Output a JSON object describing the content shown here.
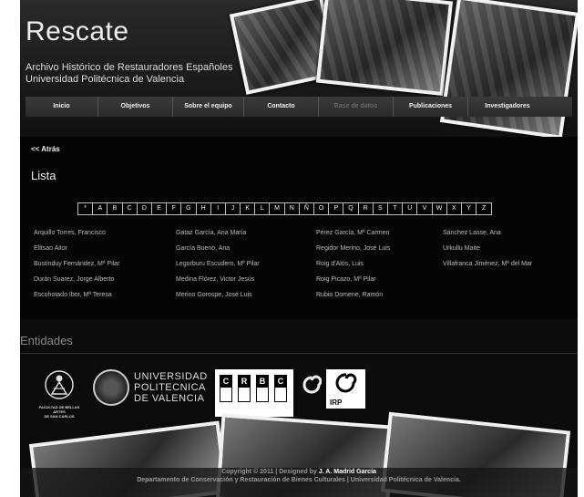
{
  "header": {
    "title": "Rescate",
    "subtitle_line1": "Archivo Histórico de Restauradores Españoles",
    "subtitle_line2": "Universidad Politécnica de Valencia"
  },
  "nav": {
    "items": [
      {
        "label": "Inicio"
      },
      {
        "label": "Objetivos"
      },
      {
        "label": "Sobre el equipo"
      },
      {
        "label": "Contacto"
      },
      {
        "label": "Base de datos"
      },
      {
        "label": "Publicaciones"
      },
      {
        "label": "Investigadores"
      }
    ]
  },
  "content": {
    "back_link": "<< Atrás",
    "list_title": "Lista",
    "alphabet": [
      "*",
      "A",
      "B",
      "C",
      "D",
      "E",
      "F",
      "G",
      "H",
      "I",
      "J",
      "K",
      "L",
      "M",
      "N",
      "Ñ",
      "O",
      "P",
      "Q",
      "R",
      "S",
      "T",
      "U",
      "V",
      "W",
      "X",
      "Y",
      "Z"
    ],
    "names": [
      "Arquillo Torres, Francisco",
      "Gataz García, Ana María",
      "Pérez García, Mª Carmen",
      "Sánchez Lasse, Ana",
      "Elitsao Aitor",
      "García Bueno, Ana",
      "Regidor Merino, José Luis",
      "Urkullu Maite",
      "Bustinduy Fernández, Mª Pilar",
      "Legorburu Escudero, Mª Pilar",
      "Roig d'Alós, Luis",
      "Villafranca Jiménez, Mª del Mar",
      "Durán Suarez, Jorge Alberto",
      "Medina Flórez, Victor Jesús",
      "Roig Picazo, Mª Pilar",
      "",
      "Escohotado Ibor, Mª Teresa",
      "Merino Gorospe, José Luis",
      "Rubio Domene, Ramón",
      ""
    ]
  },
  "entities": {
    "heading": "Entidades",
    "bba_label_1": "FACULTAD DE BELLAS ARTES",
    "bba_label_2": "DE SAN CARLOS",
    "upv_line1": "UNIVERSIDAD",
    "upv_line2": "POLITECNICA",
    "upv_line3": "DE VALENCIA",
    "crbc_letters": [
      "C",
      "R",
      "B",
      "C"
    ],
    "irp_label": "IRP"
  },
  "footer": {
    "line1_prefix": "Copyright © 2011 | Designed by ",
    "line1_author": "J. A. Madrid García",
    "line2": "Departamento de Conservación y Restauración de Bienes Culturales | Universidad Politécnica de Valencia."
  },
  "colors": {
    "background": "#000000",
    "text_light": "#eeeeee",
    "text_muted": "#bbbbbb",
    "nav_bar": "#2b2b2b"
  }
}
